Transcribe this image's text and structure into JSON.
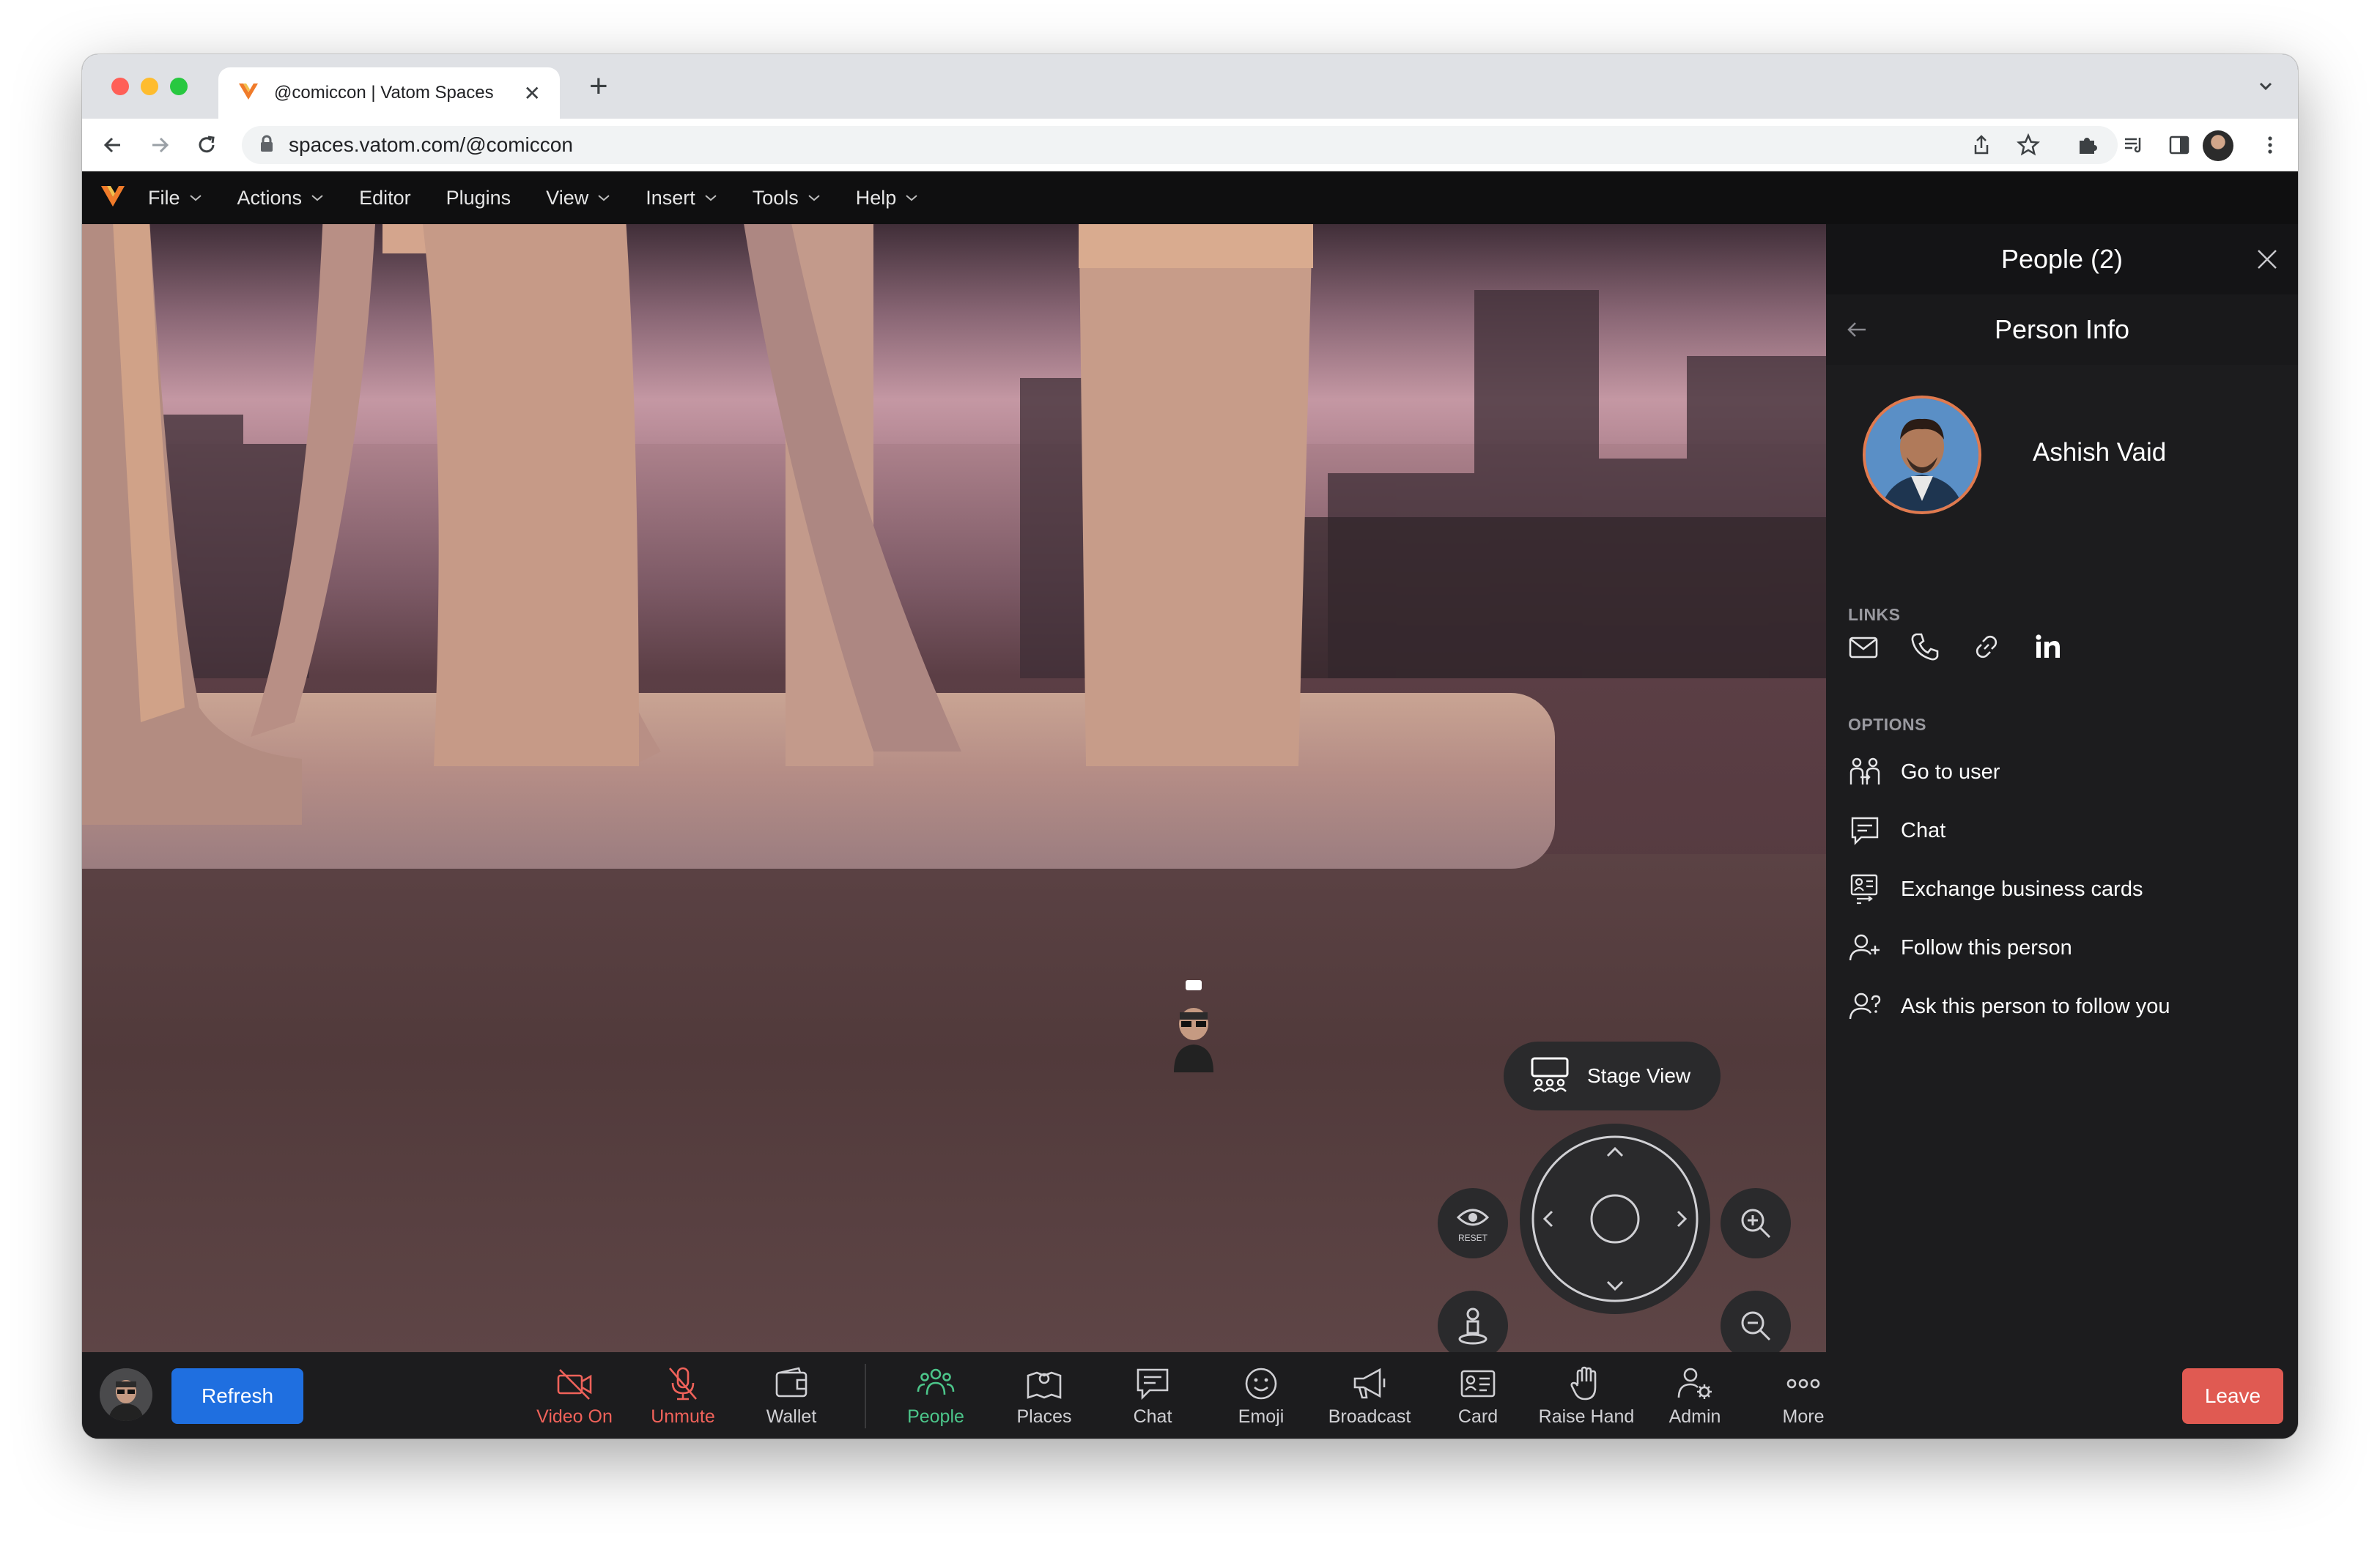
{
  "browser": {
    "tab_title": "@comiccon | Vatom Spaces",
    "url": "spaces.vatom.com/@comiccon",
    "new_tab_symbol": "+",
    "close_tab_symbol": "✕"
  },
  "menu": {
    "items": [
      {
        "label": "File",
        "dropdown": true
      },
      {
        "label": "Actions",
        "dropdown": true
      },
      {
        "label": "Editor",
        "dropdown": false
      },
      {
        "label": "Plugins",
        "dropdown": false
      },
      {
        "label": "View",
        "dropdown": true
      },
      {
        "label": "Insert",
        "dropdown": true
      },
      {
        "label": "Tools",
        "dropdown": true
      },
      {
        "label": "Help",
        "dropdown": true
      }
    ]
  },
  "scene": {
    "stage_view_label": "Stage View",
    "reset_label": "RESET"
  },
  "panel": {
    "title": "People (2)",
    "subtitle": "Person Info",
    "person_name": "Ashish Vaid",
    "links_label": "LINKS",
    "options_label": "OPTIONS",
    "options": [
      {
        "label": "Go to user",
        "icon": "go-to-user-icon"
      },
      {
        "label": "Chat",
        "icon": "chat-icon"
      },
      {
        "label": "Exchange business cards",
        "icon": "business-card-icon"
      },
      {
        "label": "Follow this person",
        "icon": "follow-person-icon"
      },
      {
        "label": "Ask this person to follow you",
        "icon": "ask-follow-icon"
      }
    ]
  },
  "bottombar": {
    "refresh_label": "Refresh",
    "leave_label": "Leave",
    "items": [
      {
        "label": "Video On",
        "icon": "video-off-icon",
        "state": "red"
      },
      {
        "label": "Unmute",
        "icon": "mic-off-icon",
        "state": "red"
      },
      {
        "label": "Wallet",
        "icon": "wallet-icon",
        "state": "normal"
      },
      {
        "label": "People",
        "icon": "people-icon",
        "state": "active"
      },
      {
        "label": "Places",
        "icon": "places-icon",
        "state": "normal"
      },
      {
        "label": "Chat",
        "icon": "chat-icon",
        "state": "normal"
      },
      {
        "label": "Emoji",
        "icon": "emoji-icon",
        "state": "normal"
      },
      {
        "label": "Broadcast",
        "icon": "broadcast-icon",
        "state": "normal"
      },
      {
        "label": "Card",
        "icon": "card-icon",
        "state": "normal"
      },
      {
        "label": "Raise Hand",
        "icon": "raise-hand-icon",
        "state": "normal"
      },
      {
        "label": "Admin",
        "icon": "admin-icon",
        "state": "normal"
      },
      {
        "label": "More",
        "icon": "more-icon",
        "state": "normal"
      }
    ]
  },
  "colors": {
    "accent_blue": "#1f6fe0",
    "leave_red": "#e05a52",
    "active_green": "#4cc58a",
    "muted_red": "#f0625a",
    "logo_orange": "#f07b2a"
  }
}
